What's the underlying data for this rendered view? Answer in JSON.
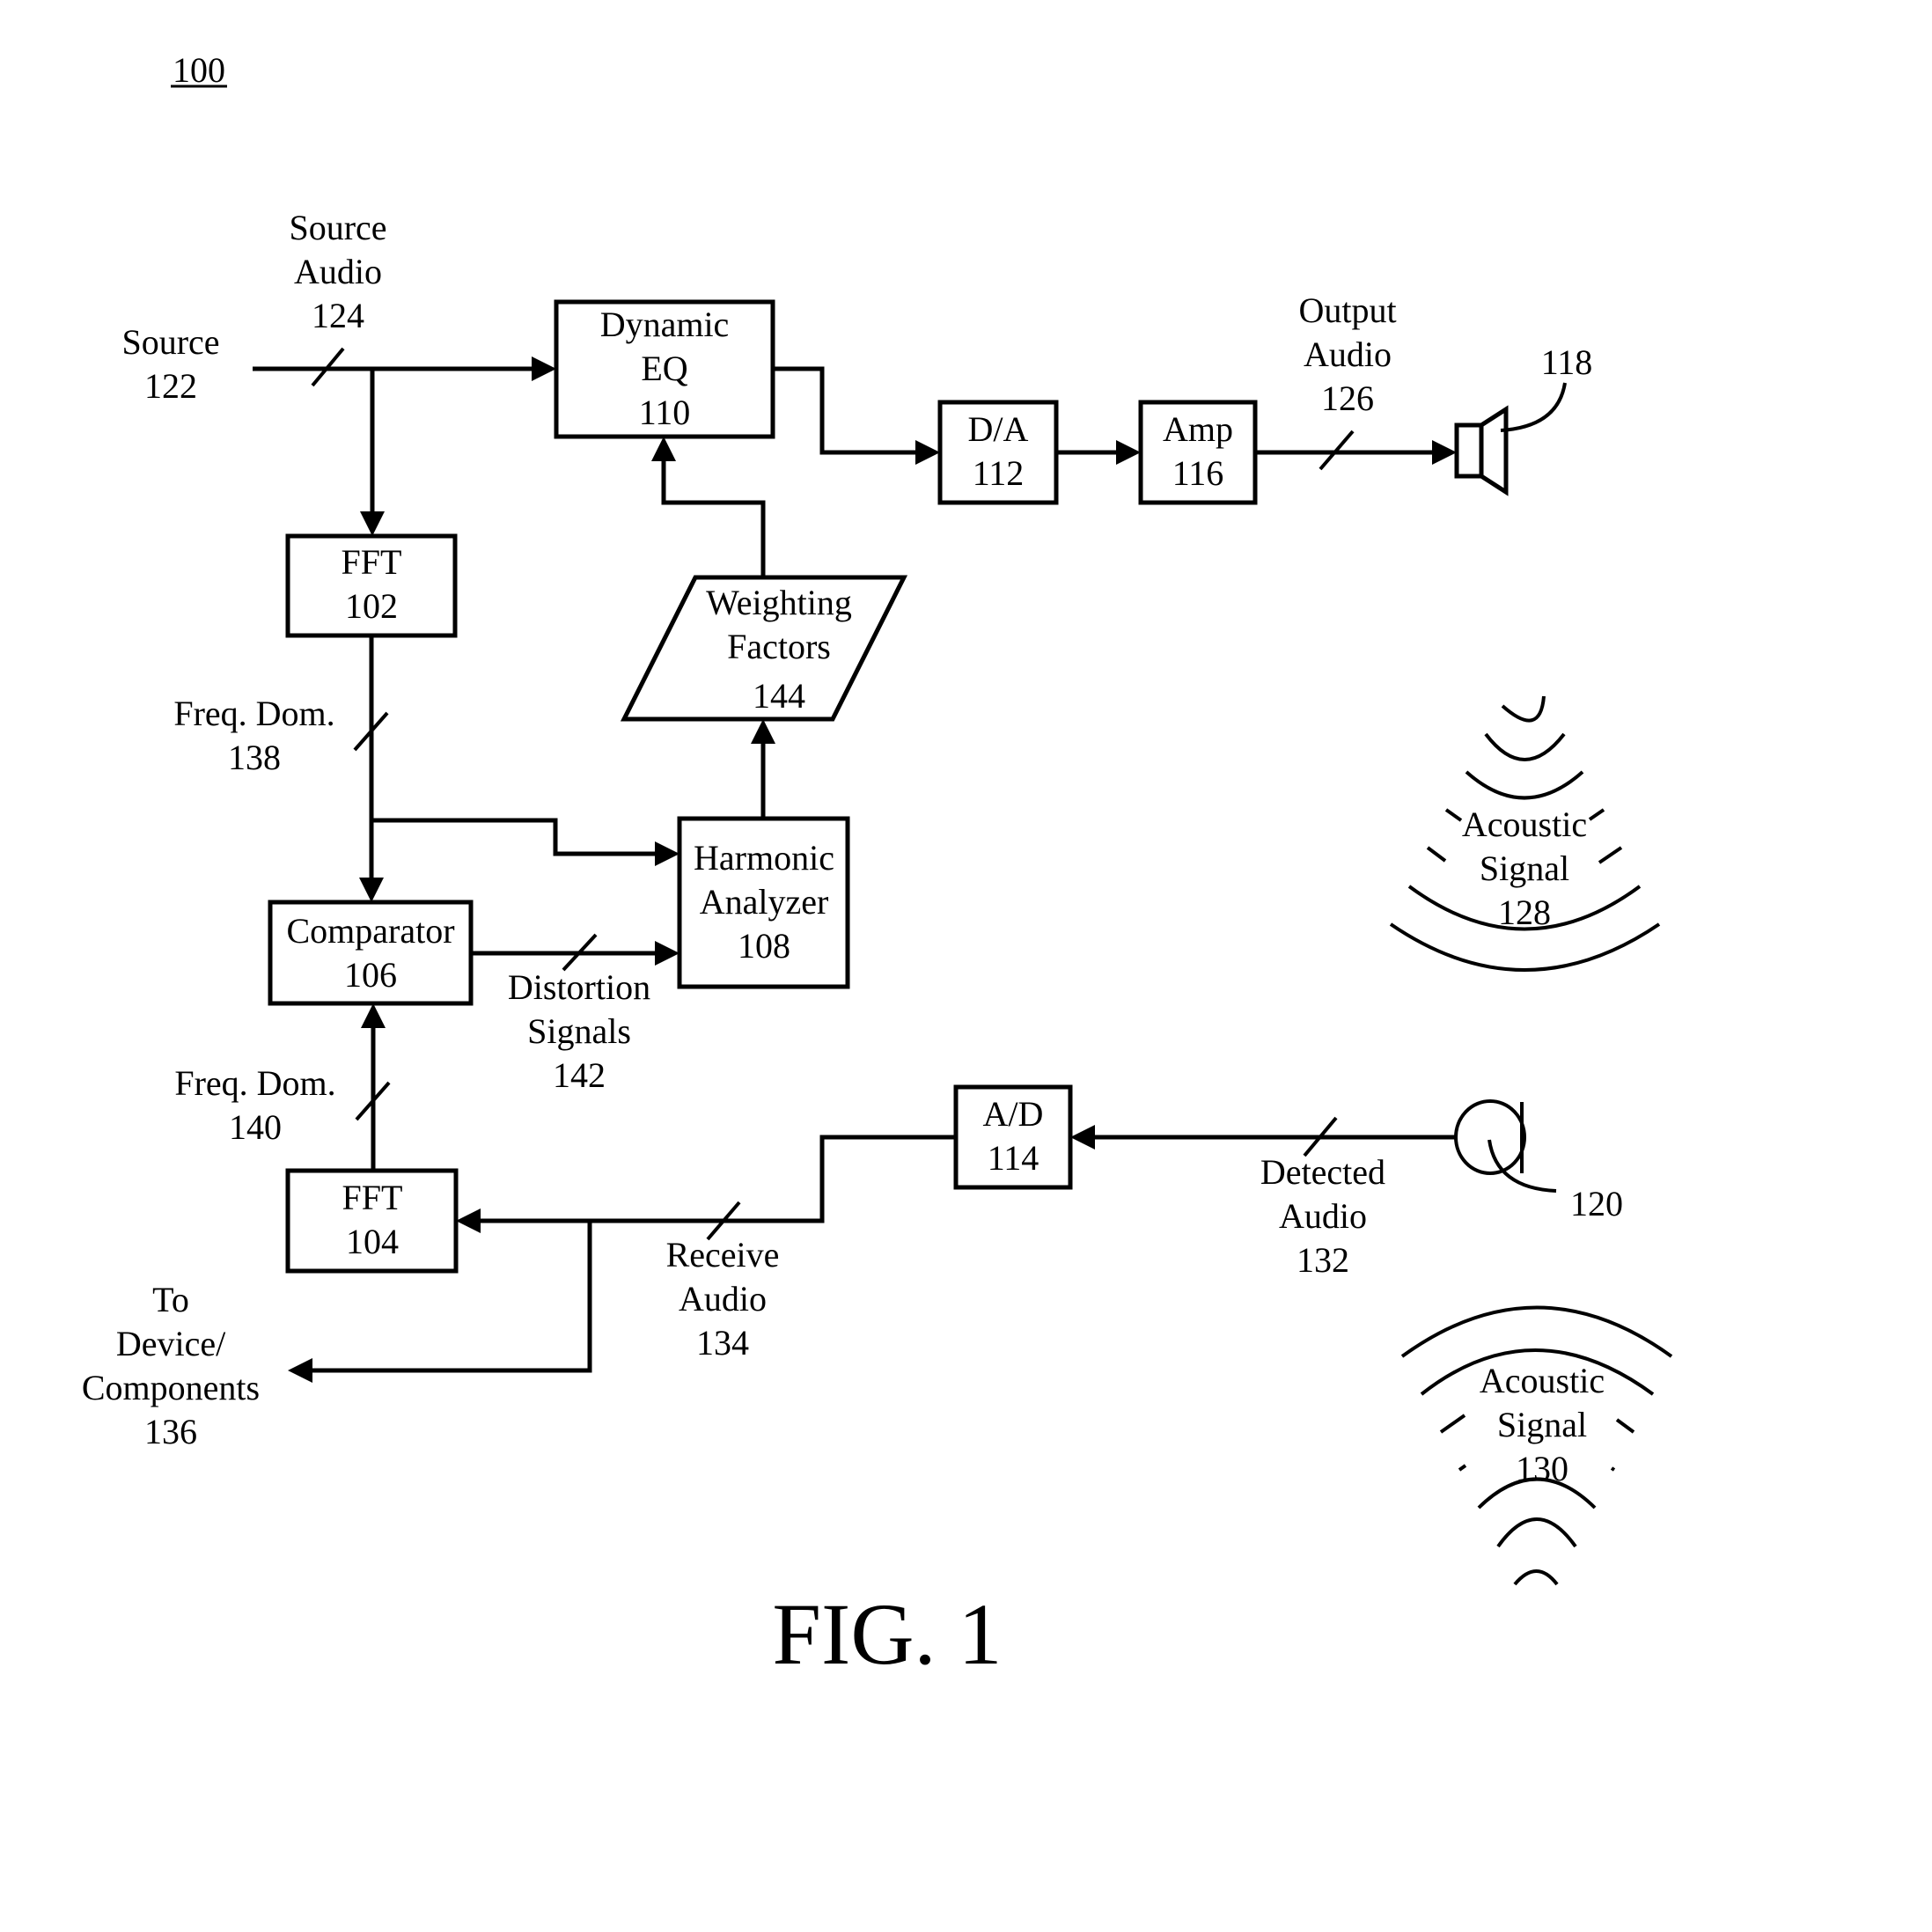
{
  "figure": {
    "ref": "100",
    "caption": "FIG. 1"
  },
  "blocks": {
    "dynamic_eq": [
      "Dynamic",
      "EQ",
      "110"
    ],
    "da": [
      "D/A",
      "112"
    ],
    "amp": [
      "Amp",
      "116"
    ],
    "fft102": [
      "FFT",
      "102"
    ],
    "weighting": [
      "Weighting",
      "Factors",
      "144"
    ],
    "harmonic": [
      "Harmonic",
      "Analyzer",
      "108"
    ],
    "comparator": [
      "Comparator",
      "106"
    ],
    "fft104": [
      "FFT",
      "104"
    ],
    "ad": [
      "A/D",
      "114"
    ]
  },
  "labels": {
    "source": [
      "Source",
      "122"
    ],
    "source_audio": [
      "Source",
      "Audio",
      "124"
    ],
    "output_audio": [
      "Output",
      "Audio",
      "126"
    ],
    "speaker_ref": "118",
    "mic_ref": "120",
    "freq_dom_138": [
      "Freq. Dom.",
      "138"
    ],
    "freq_dom_140": [
      "Freq. Dom.",
      "140"
    ],
    "distortion": [
      "Distortion",
      "Signals",
      "142"
    ],
    "detected_audio": [
      "Detected",
      "Audio",
      "132"
    ],
    "receive_audio": [
      "Receive",
      "Audio",
      "134"
    ],
    "to_device": [
      "To",
      "Device/",
      "Components",
      "136"
    ],
    "acoustic_128": [
      "Acoustic",
      "Signal",
      "128"
    ],
    "acoustic_130": [
      "Acoustic",
      "Signal",
      "130"
    ]
  }
}
